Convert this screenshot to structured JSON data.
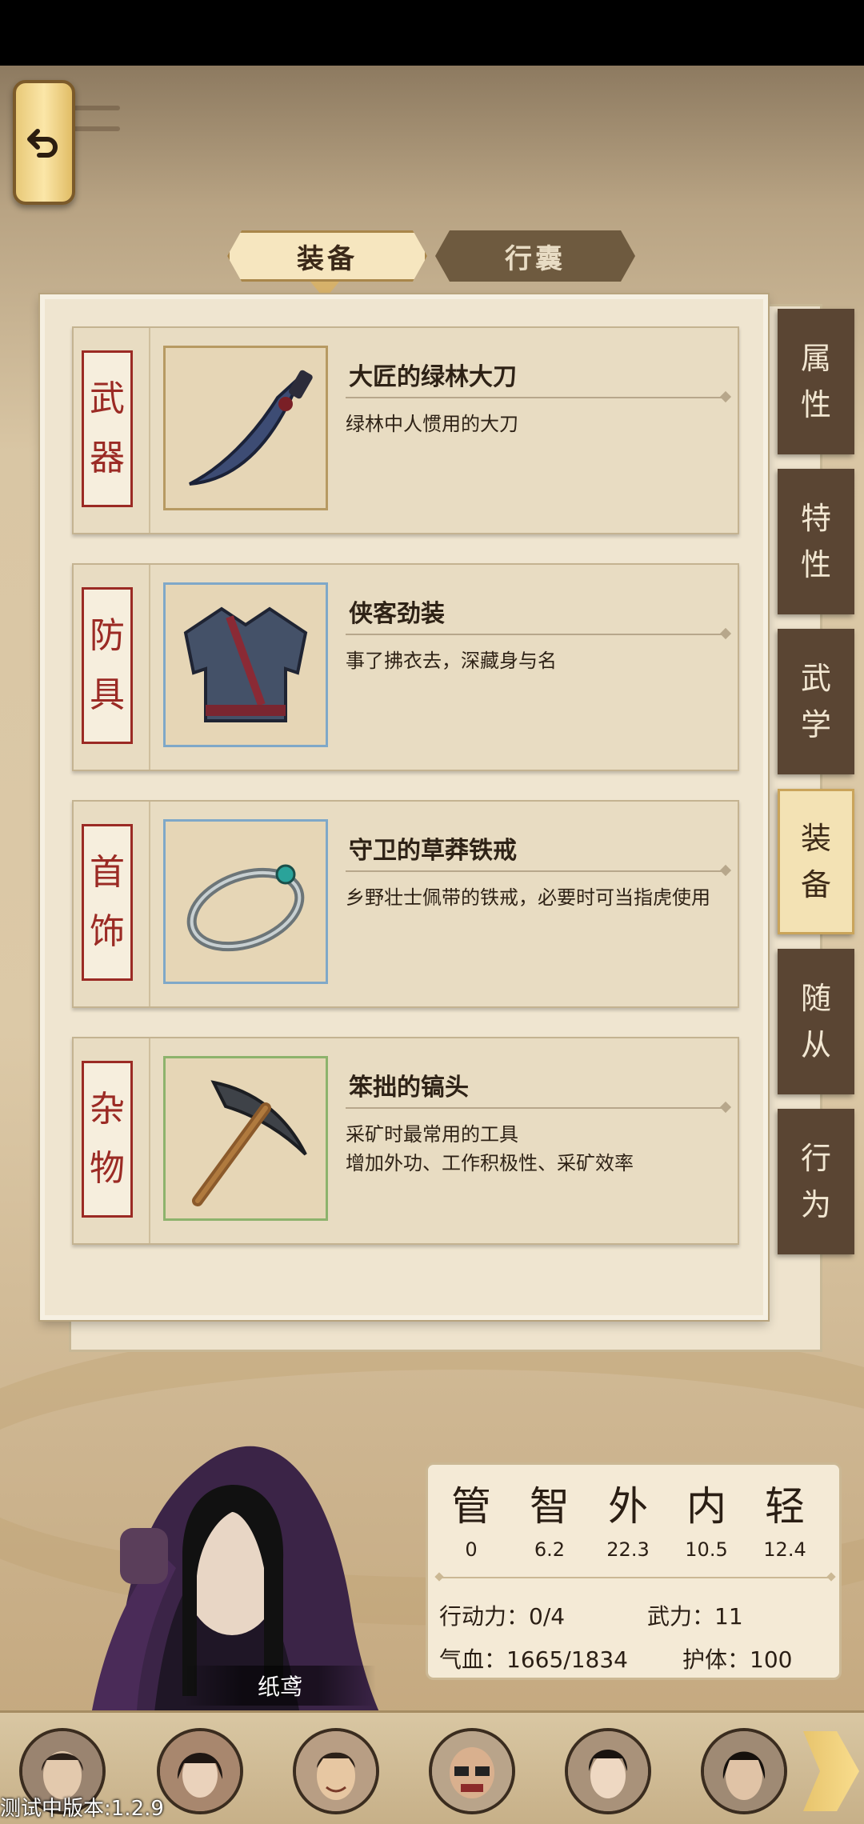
{
  "tabs": {
    "equip": "装备",
    "bag": "行囊"
  },
  "side_tabs": [
    {
      "label": "属性",
      "c1": "属",
      "c2": "性"
    },
    {
      "label": "特性",
      "c1": "特",
      "c2": "性"
    },
    {
      "label": "武学",
      "c1": "武",
      "c2": "学"
    },
    {
      "label": "装备",
      "c1": "装",
      "c2": "备"
    },
    {
      "label": "随从",
      "c1": "随",
      "c2": "从"
    },
    {
      "label": "行为",
      "c1": "行",
      "c2": "为"
    }
  ],
  "equipment": [
    {
      "slot_c1": "武",
      "slot_c2": "器",
      "name": "大匠的绿林大刀",
      "desc_1": "绿林中人惯用的大刀",
      "desc_2": "",
      "icon": "saber-icon"
    },
    {
      "slot_c1": "防",
      "slot_c2": "具",
      "name": "侠客劲装",
      "desc_1": "事了拂衣去，深藏身与名",
      "desc_2": "",
      "icon": "armor-icon"
    },
    {
      "slot_c1": "首",
      "slot_c2": "饰",
      "name": "守卫的草莽铁戒",
      "desc_1": "乡野壮士佩带的铁戒，必要时可当指虎使用",
      "desc_2": "",
      "icon": "ring-icon"
    },
    {
      "slot_c1": "杂",
      "slot_c2": "物",
      "name": "笨拙的镐头",
      "desc_1": "采矿时最常用的工具",
      "desc_2": "增加外功、工作积极性、采矿效率",
      "icon": "pickaxe-icon"
    }
  ],
  "character": {
    "name": "纸鸢"
  },
  "stats": {
    "attrs": [
      {
        "glyph": "管",
        "value": "0"
      },
      {
        "glyph": "智",
        "value": "6.2"
      },
      {
        "glyph": "外",
        "value": "22.3"
      },
      {
        "glyph": "内",
        "value": "10.5"
      },
      {
        "glyph": "轻",
        "value": "12.4"
      }
    ],
    "action_power": "行动力：0/4",
    "martial_power": "武力：11",
    "hp": "气血：1665/1834",
    "protection": "护体：100"
  },
  "version": "测试中版本:1.2.9",
  "colors": {
    "slot_red": "#9b2a24",
    "side_tab_dark": "#5a4533",
    "active_gold": "#f3e2b4"
  }
}
